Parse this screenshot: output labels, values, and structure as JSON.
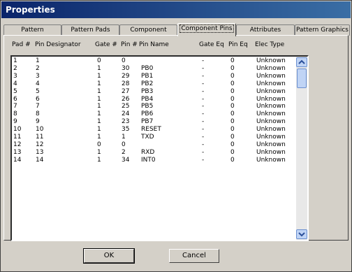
{
  "window": {
    "title": "Properties"
  },
  "tabs": [
    "Pattern",
    "Pattern Pads",
    "Component",
    "Component Pins",
    "Attributes",
    "Pattern Graphics"
  ],
  "columns": [
    "Pad #",
    "Pin Designator",
    "Gate #",
    "Pin #",
    "Pin Name",
    "Gate Eq",
    "Pin Eq",
    "Elec Type"
  ],
  "rows": [
    [
      "1",
      "1",
      "0",
      "0",
      "",
      "-",
      "0",
      "Unknown"
    ],
    [
      "2",
      "2",
      "1",
      "30",
      "PB0",
      "-",
      "0",
      "Unknown"
    ],
    [
      "3",
      "3",
      "1",
      "29",
      "PB1",
      "-",
      "0",
      "Unknown"
    ],
    [
      "4",
      "4",
      "1",
      "28",
      "PB2",
      "-",
      "0",
      "Unknown"
    ],
    [
      "5",
      "5",
      "1",
      "27",
      "PB3",
      "-",
      "0",
      "Unknown"
    ],
    [
      "6",
      "6",
      "1",
      "26",
      "PB4",
      "-",
      "0",
      "Unknown"
    ],
    [
      "7",
      "7",
      "1",
      "25",
      "PB5",
      "-",
      "0",
      "Unknown"
    ],
    [
      "8",
      "8",
      "1",
      "24",
      "PB6",
      "-",
      "0",
      "Unknown"
    ],
    [
      "9",
      "9",
      "1",
      "23",
      "PB7",
      "-",
      "0",
      "Unknown"
    ],
    [
      "10",
      "10",
      "1",
      "35",
      "RESET",
      "-",
      "0",
      "Unknown"
    ],
    [
      "11",
      "11",
      "1",
      "1",
      "TXD",
      "-",
      "0",
      "Unknown"
    ],
    [
      "12",
      "12",
      "0",
      "0",
      "",
      "-",
      "0",
      "Unknown"
    ],
    [
      "13",
      "13",
      "1",
      "2",
      "RXD",
      "-",
      "0",
      "Unknown"
    ],
    [
      "14",
      "14",
      "1",
      "34",
      "INT0",
      "-",
      "0",
      "Unknown"
    ]
  ],
  "buttons": {
    "ok": "OK",
    "cancel": "Cancel"
  }
}
